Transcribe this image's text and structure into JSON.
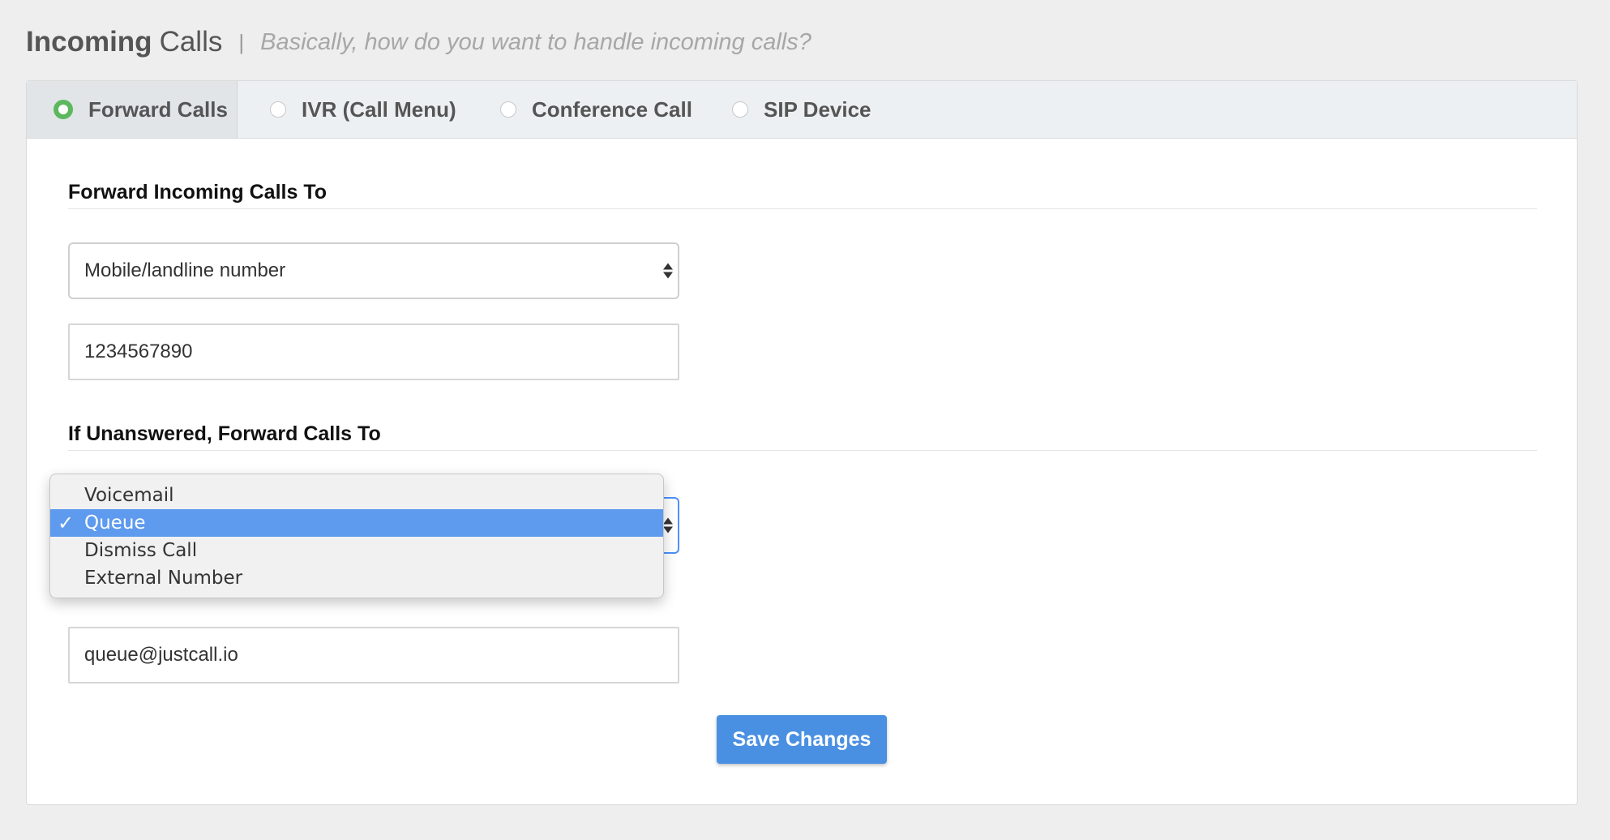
{
  "header": {
    "title_bold": "Incoming",
    "title_light": "Calls",
    "separator": "|",
    "subtitle": "Basically, how do you want to handle incoming calls?"
  },
  "tabs": [
    {
      "label": "Forward Calls",
      "selected": true
    },
    {
      "label": "IVR (Call Menu)",
      "selected": false
    },
    {
      "label": "Conference Call",
      "selected": false
    },
    {
      "label": "SIP Device",
      "selected": false
    }
  ],
  "forward_section": {
    "title": "Forward Incoming Calls To",
    "type_select": {
      "value": "Mobile/landline number"
    },
    "number_input": {
      "value": "1234567890"
    }
  },
  "unanswered_section": {
    "title": "If Unanswered, Forward Calls To",
    "dropdown": {
      "options": [
        {
          "label": "Voicemail",
          "selected": false
        },
        {
          "label": "Queue",
          "selected": true
        },
        {
          "label": "Dismiss Call",
          "selected": false
        },
        {
          "label": "External Number",
          "selected": false
        }
      ],
      "check_mark": "✓"
    },
    "email_input": {
      "value": "queue@justcall.io"
    }
  },
  "actions": {
    "save_label": "Save Changes"
  },
  "colors": {
    "page_background": "#eeeeee",
    "active_radio": "#5cb85c",
    "primary_button": "#4a90e2",
    "menu_highlight": "#5e9aee",
    "focus_border": "#4d90fe"
  },
  "icons": {
    "radio_selected": "radio-checked-icon",
    "radio_unselected": "radio-unchecked-icon",
    "select_arrows": "select-updown-icon",
    "check": "checkmark-icon"
  }
}
